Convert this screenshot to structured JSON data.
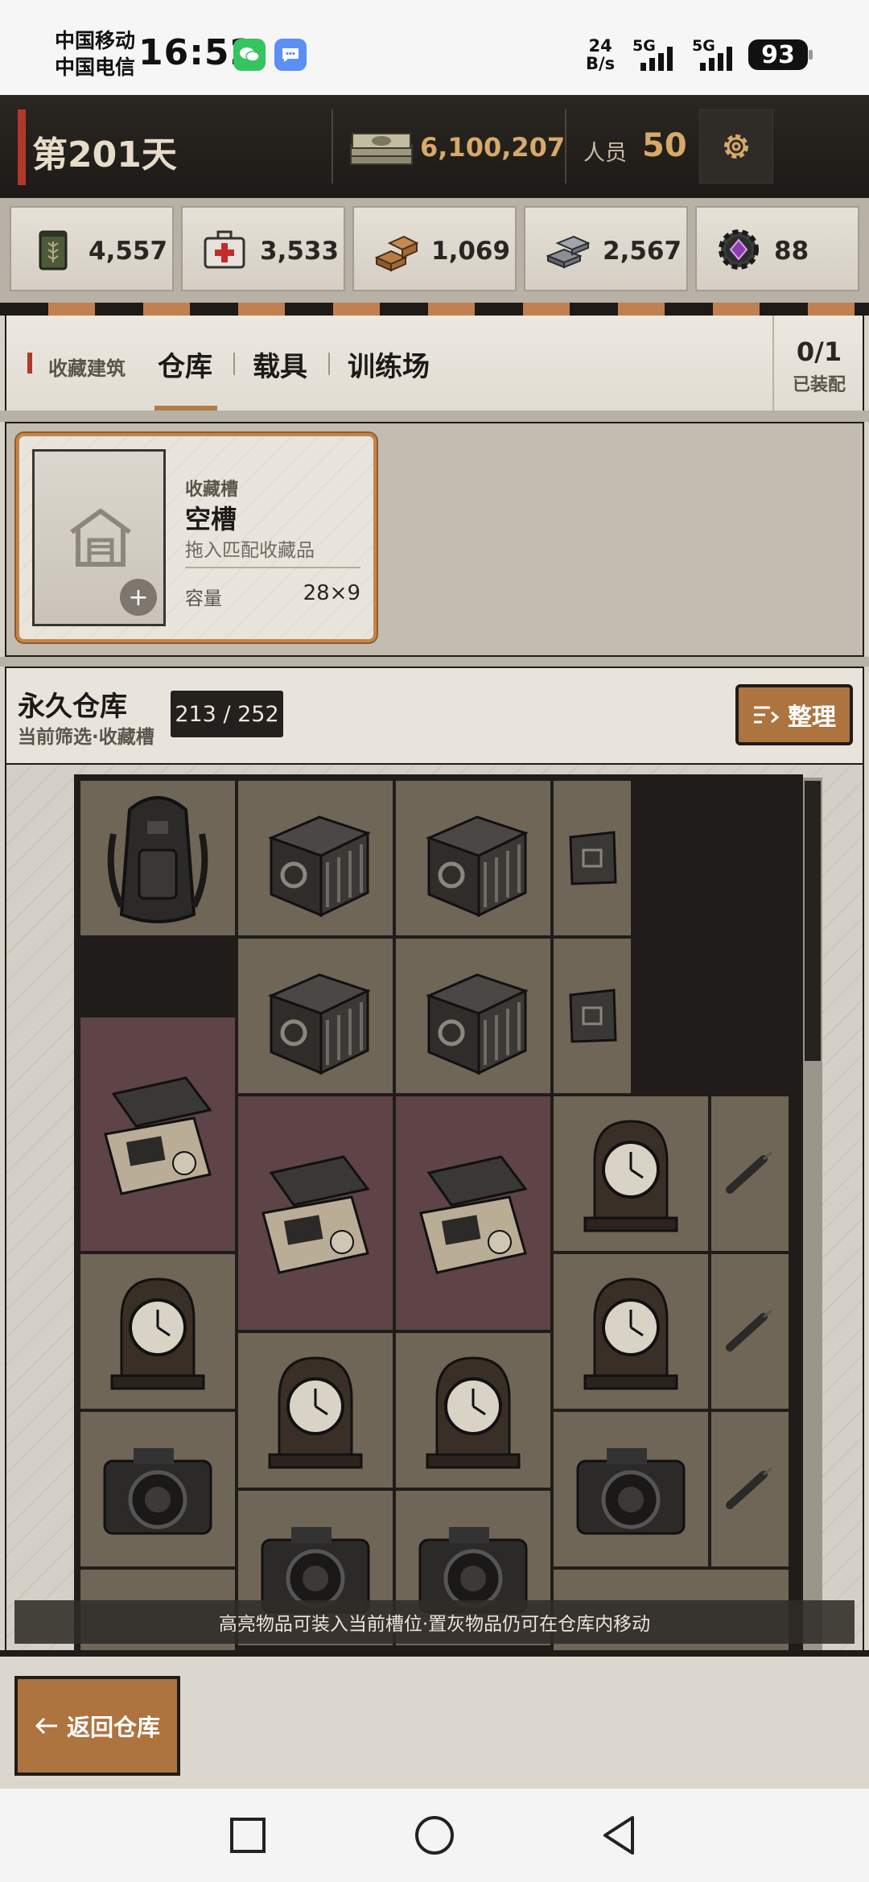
{
  "status_bar": {
    "carrier1": "中国移动",
    "carrier2": "中国电信",
    "time": "16:52",
    "net_speed_value": "24",
    "net_speed_unit": "B/s",
    "signal1_label": "5G",
    "signal2_label": "5G",
    "battery": "93"
  },
  "header": {
    "day": "第201天",
    "cash": "6,100,207",
    "staff_label": "人员",
    "staff_value": "50",
    "settings_icon": "gear-icon"
  },
  "resources": [
    {
      "icon": "ration-can-icon",
      "value": "4,557"
    },
    {
      "icon": "medkit-icon",
      "value": "3,533"
    },
    {
      "icon": "wood-icon",
      "value": "1,069"
    },
    {
      "icon": "steel-icon",
      "value": "2,567"
    },
    {
      "icon": "gem-gear-icon",
      "value": "88"
    }
  ],
  "tabs": {
    "section_label": "收藏建筑",
    "items": [
      {
        "label": "仓库",
        "active": true
      },
      {
        "label": "载具",
        "active": false
      },
      {
        "label": "训练场",
        "active": false
      }
    ],
    "equip_count": "0/1",
    "equip_label": "已装配"
  },
  "slot": {
    "type_label": "收藏槽",
    "name": "空槽",
    "hint": "拖入匹配收藏品",
    "capacity_label": "容量",
    "capacity_value": "28×9"
  },
  "warehouse": {
    "title": "永久仓库",
    "filter": "当前筛选·收藏槽",
    "count": "213 / 252",
    "sort_label": "整理",
    "items": [
      {
        "name": "backpack",
        "highlight": false
      },
      {
        "name": "pipe-crate",
        "highlight": false
      },
      {
        "name": "pipe-crate",
        "highlight": false
      },
      {
        "name": "pouch",
        "highlight": false
      },
      {
        "name": "pipe-crate",
        "highlight": false
      },
      {
        "name": "pipe-crate",
        "highlight": false
      },
      {
        "name": "pouch",
        "highlight": false
      },
      {
        "name": "medical-device",
        "highlight": true
      },
      {
        "name": "medical-device",
        "highlight": true
      },
      {
        "name": "medical-device",
        "highlight": true
      },
      {
        "name": "mantel-clock",
        "highlight": false
      },
      {
        "name": "syringe",
        "highlight": false
      },
      {
        "name": "mantel-clock",
        "highlight": false
      },
      {
        "name": "mantel-clock",
        "highlight": false
      },
      {
        "name": "syringe",
        "highlight": false
      },
      {
        "name": "mantel-clock",
        "highlight": false
      },
      {
        "name": "mantel-clock",
        "highlight": false
      },
      {
        "name": "camera",
        "highlight": false
      },
      {
        "name": "camera",
        "highlight": false
      },
      {
        "name": "syringe",
        "highlight": false
      },
      {
        "name": "camera",
        "highlight": false
      },
      {
        "name": "camera",
        "highlight": false
      }
    ],
    "notice": "高亮物品可装入当前槽位·置灰物品仍可在仓库内移动"
  },
  "footer": {
    "back_label": "返回仓库"
  },
  "colors": {
    "accent": "#ad7440",
    "header_bg": "#1d1a17",
    "gold_text": "#d7a96a",
    "highlight_cell": "#5e4446",
    "normal_cell": "#6f6658"
  }
}
